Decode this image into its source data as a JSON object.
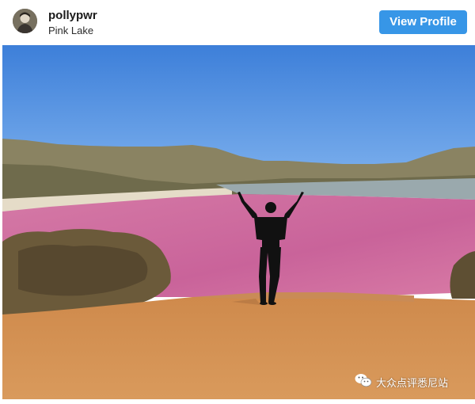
{
  "post": {
    "username": "pollypwr",
    "location": "Pink Lake",
    "view_profile_label": "View Profile"
  },
  "watermark": {
    "text": "大众点评悉尼站",
    "icon": "wechat-icon"
  },
  "colors": {
    "button": "#3796e7",
    "sky": "#5b97e6",
    "lake": "#cf6d9d",
    "ground": "#d38d4e"
  }
}
